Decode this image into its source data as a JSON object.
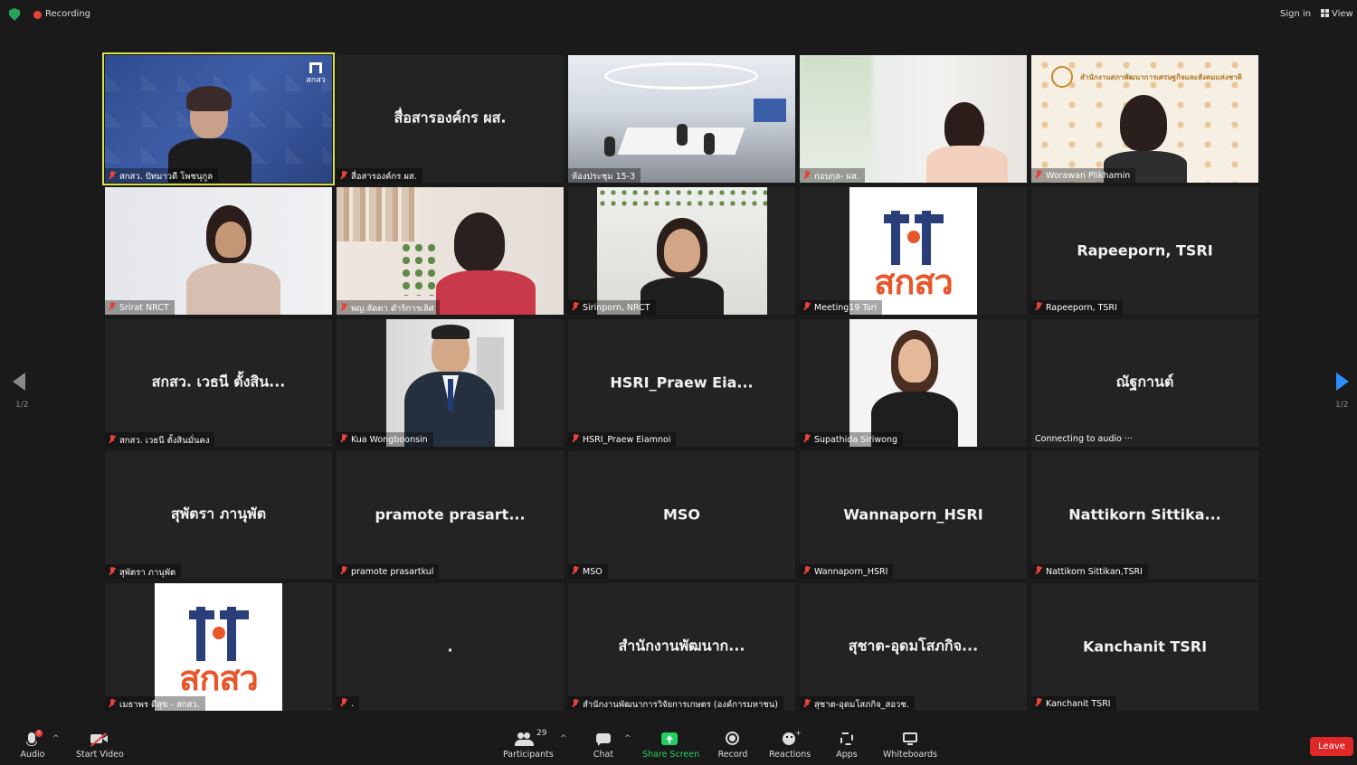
{
  "topbar": {
    "recording_label": "Recording",
    "sign_in_label": "Sign in",
    "view_label": "View"
  },
  "tiles": [
    {
      "display": "",
      "name": "สกสว. ปัทมาวดี โพชนุกูล",
      "type": "video",
      "active": true
    },
    {
      "display": "สื่อสารองค์กร ผส.",
      "name": "สื่อสารองค์กร ผส.",
      "type": "text"
    },
    {
      "display": "",
      "name": "ห้องประชุม 15-3",
      "type": "video"
    },
    {
      "display": "",
      "name": "กอบกุล- ผส.",
      "type": "video"
    },
    {
      "display": "",
      "name": "Worawan Plikhamin",
      "type": "video"
    },
    {
      "display": "",
      "name": "Srirat NRCT",
      "type": "video"
    },
    {
      "display": "",
      "name": "พญ.ลัดดา ดำริการเลิศ",
      "type": "video"
    },
    {
      "display": "",
      "name": "Sirinporn, NRCT",
      "type": "video"
    },
    {
      "display": "",
      "name": "Meeting19 Tsri",
      "type": "logo"
    },
    {
      "display": "Rapeeporn, TSRI",
      "name": "Rapeeporn, TSRI",
      "type": "text"
    },
    {
      "display": "สกสว. เวธนี ตั้งสิน...",
      "name": "สกสว. เวธนี ตั้งสินมั่นคง",
      "type": "text"
    },
    {
      "display": "",
      "name": "Kua Wongboonsin",
      "type": "photo"
    },
    {
      "display": "HSRI_Praew Eia...",
      "name": "HSRI_Praew Eiamnoi",
      "type": "text"
    },
    {
      "display": "",
      "name": "Supathida Siriwong",
      "type": "photo"
    },
    {
      "display": "ณัฐกานต์",
      "name": "Connecting to audio ···",
      "type": "text"
    },
    {
      "display": "สุพัตรา ภานุพัต",
      "name": "สุพัตรา ภานุพัต",
      "type": "text"
    },
    {
      "display": "pramote prasart...",
      "name": "pramote prasartkul",
      "type": "text"
    },
    {
      "display": "MSO",
      "name": "MSO",
      "type": "text"
    },
    {
      "display": "Wannaporn_HSRI",
      "name": "Wannaporn_HSRI",
      "type": "text"
    },
    {
      "display": "Nattikorn Sittika...",
      "name": "Nattikorn Sittikan,TSRI",
      "type": "text"
    },
    {
      "display": "",
      "name": "เมธาพร ดีสุข - สกสว.",
      "type": "logo"
    },
    {
      "display": ".",
      "name": ".",
      "type": "text"
    },
    {
      "display": "สำนักงานพัฒนาก...",
      "name": "สำนักงานพัฒนาการวิจัยการเกษตร (องค์การมหาชน)",
      "type": "text"
    },
    {
      "display": "สุชาต-อุดมโสภกิจ...",
      "name": "สุชาต-อุดมโสภกิจ_สอวช.",
      "type": "text"
    },
    {
      "display": "Kanchanit TSRI",
      "name": "Kanchanit TSRI",
      "type": "text"
    }
  ],
  "logo_text": "สกสว",
  "logo_corner_text": "สกสว",
  "banner_text": "สำนักงานสภาพัฒนาการเศรษฐกิจและสังคมแห่งชาติ",
  "pagination": {
    "left": "1/2",
    "right": "1/2"
  },
  "toolbar": {
    "audio": "Audio",
    "audio_badge": "!",
    "start_video": "Start Video",
    "participants": "Participants",
    "participants_count": "29",
    "chat": "Chat",
    "share_screen": "Share Screen",
    "record": "Record",
    "reactions": "Reactions",
    "apps": "Apps",
    "whiteboards": "Whiteboards",
    "leave": "Leave"
  },
  "colors": {
    "background": "#1a1a1a",
    "tile": "#232323",
    "active_border": "#d7e04a",
    "share_green": "#23d160",
    "leave_red": "#e02828",
    "accent_blue": "#2d8cff",
    "logo_blue": "#2a3f7a",
    "logo_orange": "#e8562a"
  }
}
